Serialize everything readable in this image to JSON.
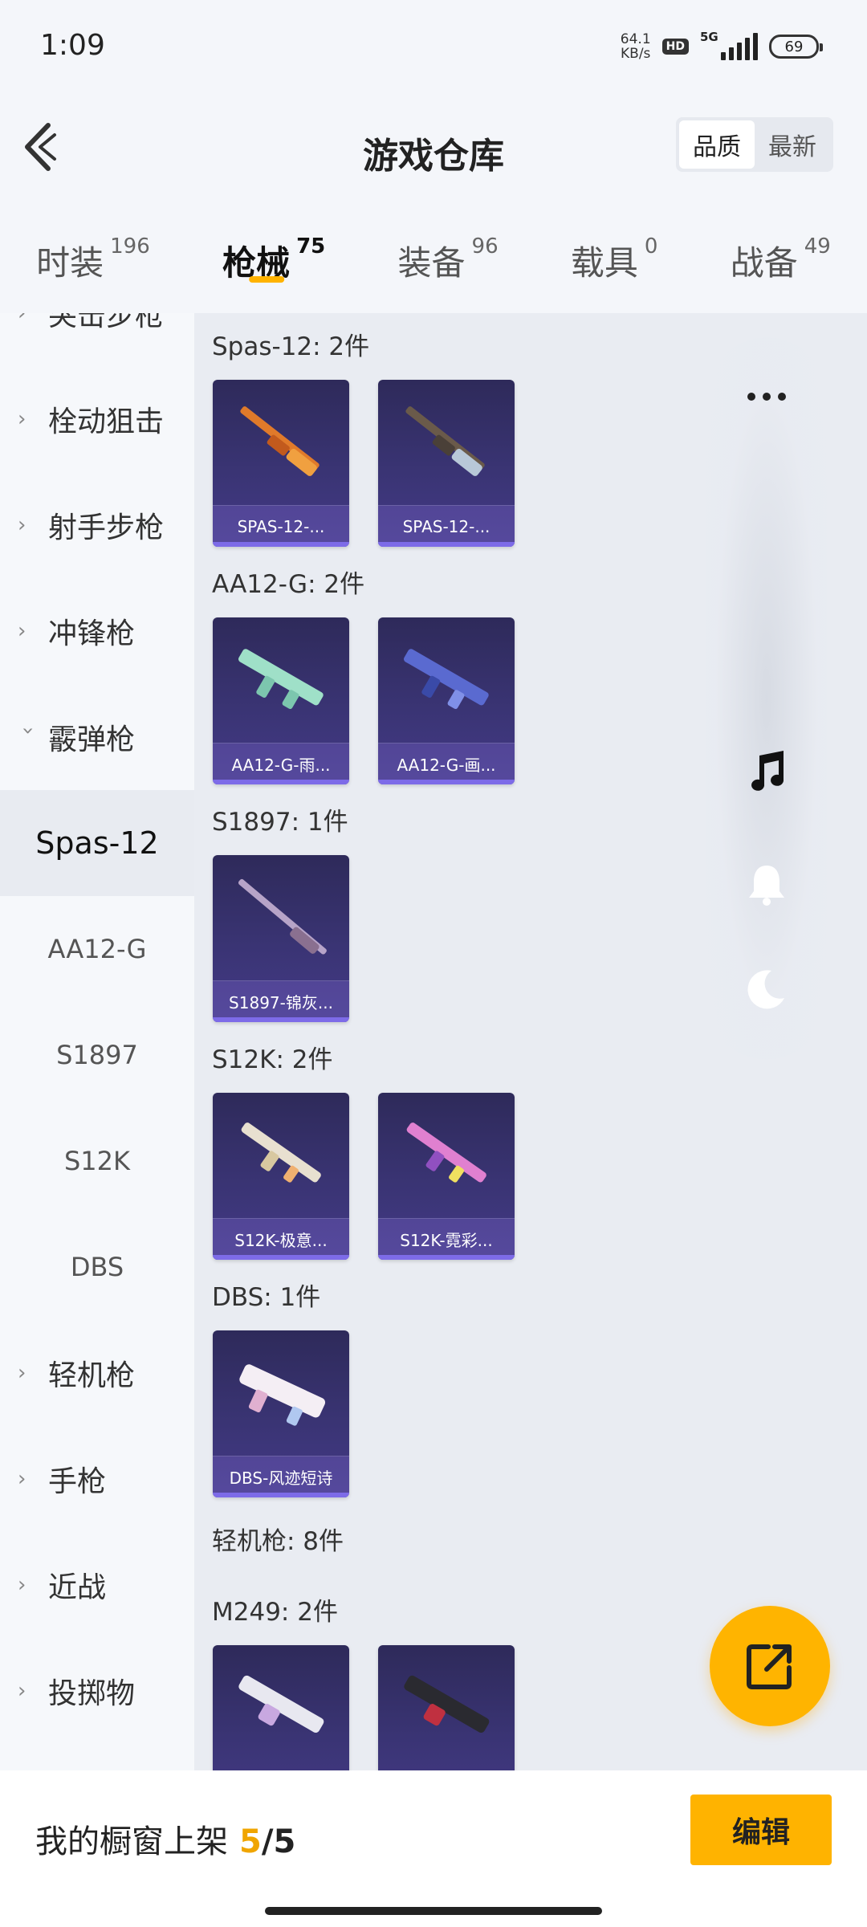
{
  "status": {
    "time": "1:09",
    "net_speed_value": "64.1",
    "net_speed_unit": "KB/s",
    "hd": "HD",
    "network": "5G",
    "battery": "69"
  },
  "header": {
    "title": "游戏仓库",
    "sort_options": [
      "品质",
      "最新"
    ],
    "sort_selected": "品质"
  },
  "tabs": [
    {
      "label": "时装",
      "count": "196"
    },
    {
      "label": "枪械",
      "count": "75"
    },
    {
      "label": "装备",
      "count": "96"
    },
    {
      "label": "载具",
      "count": "0"
    },
    {
      "label": "战备",
      "count": "49"
    }
  ],
  "active_tab": "枪械",
  "sidebar": {
    "groups_top": [
      "突击步枪",
      "栓动狙击",
      "射手步枪",
      "冲锋枪"
    ],
    "expanded_group": "霰弹枪",
    "sub_items": [
      "Spas-12",
      "AA12-G",
      "S1897",
      "S12K",
      "DBS"
    ],
    "active_sub": "Spas-12",
    "groups_bottom": [
      "轻机枪",
      "手枪",
      "近战",
      "投掷物"
    ]
  },
  "content": {
    "sections": [
      {
        "title": "Spas-12: 2件",
        "items": [
          "SPAS-12-...",
          "SPAS-12-..."
        ]
      },
      {
        "title": "AA12-G: 2件",
        "items": [
          "AA12-G-雨...",
          "AA12-G-画..."
        ]
      },
      {
        "title": "S1897: 1件",
        "items": [
          "S1897-锦灰..."
        ]
      },
      {
        "title": "S12K: 2件",
        "items": [
          "S12K-极意...",
          "S12K-霓彩..."
        ]
      },
      {
        "title": "DBS: 1件",
        "items": [
          "DBS-风迹短诗"
        ]
      },
      {
        "title": "轻机枪: 8件",
        "items": []
      },
      {
        "title": "M249: 2件",
        "items": [
          "",
          ""
        ]
      }
    ]
  },
  "floating_panel": {
    "icons": [
      "more-icon",
      "music-note-icon",
      "bell-icon",
      "moon-icon"
    ]
  },
  "bottom_bar": {
    "showcase_label": "我的橱窗上架",
    "showcase_current": "5",
    "showcase_separator": "/",
    "showcase_max": "5",
    "edit_label": "编辑"
  },
  "colors": {
    "accent": "#ffb300",
    "showcase_highlight": "#f0a500",
    "card_bg": "#3a3474"
  }
}
